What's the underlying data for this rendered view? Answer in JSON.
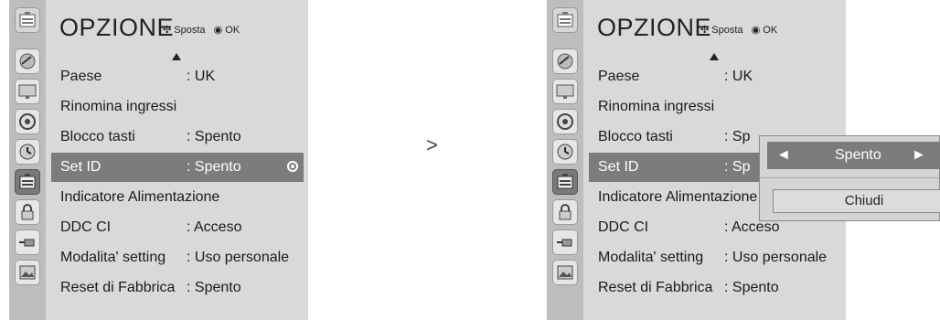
{
  "menu": {
    "title": "OPZIONE",
    "hint_move": "Sposta",
    "hint_ok": "OK",
    "rows": [
      {
        "label": "Paese",
        "value": ": UK"
      },
      {
        "label": "Rinomina ingressi",
        "value": ""
      },
      {
        "label": "Blocco tasti",
        "value": ": Spento"
      },
      {
        "label": "Set ID",
        "value": ": Spento"
      },
      {
        "label": "Indicatore Alimentazione",
        "value": ""
      },
      {
        "label": "DDC CI",
        "value": ": Acceso"
      },
      {
        "label": "Modalita' setting",
        "value": ": Uso personale"
      },
      {
        "label": "Reset di Fabbrica",
        "value": ": Spento"
      }
    ],
    "right_rows": [
      {
        "label": "Paese",
        "value": ": UK"
      },
      {
        "label": "Rinomina ingressi",
        "value": ""
      },
      {
        "label": "Blocco tasti",
        "value": ": Sp"
      },
      {
        "label": "Set ID",
        "value": ": Sp"
      },
      {
        "label": "Indicatore Alimentazione",
        "value": ""
      },
      {
        "label": "DDC CI",
        "value": ": Acceso"
      },
      {
        "label": "Modalita' setting",
        "value": ": Uso personale"
      },
      {
        "label": "Reset di Fabbrica",
        "value": ": Spento"
      }
    ]
  },
  "arrow_symbol": ">",
  "popup": {
    "left_arrow": "◄",
    "value": "Spento",
    "right_arrow": "►",
    "close_label": "Chiudi"
  },
  "icons": [
    "satellite-dish-icon",
    "monitor-icon",
    "speaker-icon",
    "clock-icon",
    "option-icon",
    "lock-icon",
    "input-plug-icon",
    "photo-icon"
  ]
}
